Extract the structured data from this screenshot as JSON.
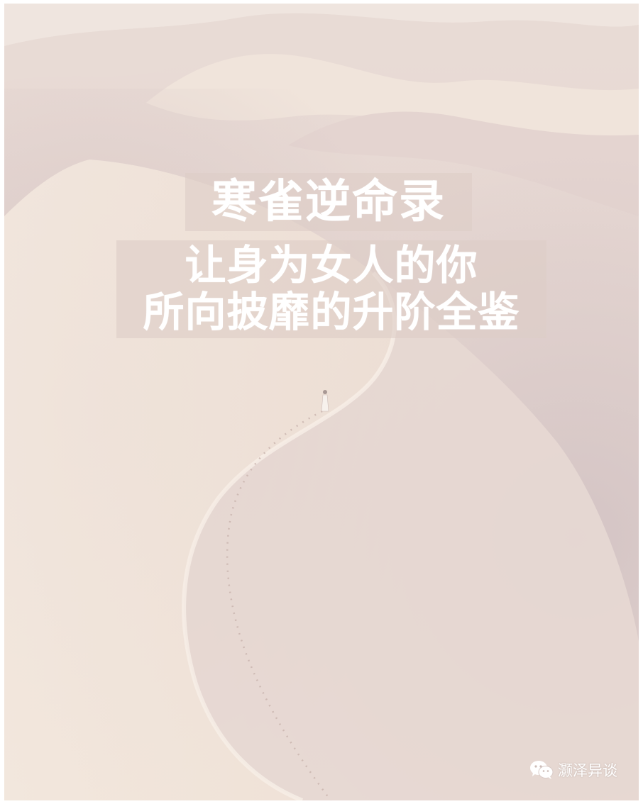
{
  "poster": {
    "title": "寒雀逆命录",
    "subtitle_line1": "让身为女人的你",
    "subtitle_line2": "所向披靡的升阶全鉴"
  },
  "watermark": {
    "icon": "wechat-icon",
    "account_name": "灏泽异谈"
  },
  "colors": {
    "sand_light": "#f1e6dd",
    "sand_shadow": "#d8c8c6",
    "title_box": "#ddcdc7",
    "text": "#ffffff"
  }
}
